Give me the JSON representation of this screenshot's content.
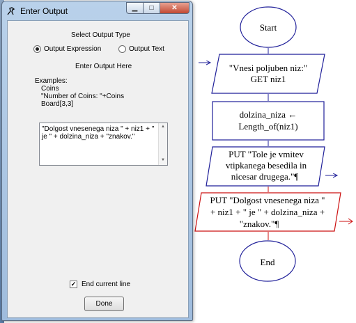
{
  "window": {
    "title": "Enter Output",
    "minimize_glyph": "▁",
    "maximize_glyph": "□",
    "close_glyph": "✕"
  },
  "dialog": {
    "select_type_label": "Select Output Type",
    "radio_expression_label": "Output Expression",
    "radio_text_label": "Output Text",
    "selected_type": "Output Expression",
    "enter_here_label": "Enter Output Here",
    "examples_heading": "Examples:",
    "example_1": "Coins",
    "example_2": "\"Number of Coins: \"+Coins",
    "example_3": "Board[3,3]",
    "output_value": "\"Dolgost vnesenega niza \" + niz1 + \" je \" + dolzina_niza + \"znakov.\"",
    "end_line_label": "End current line",
    "end_line_checked": true,
    "checkmark": "✓",
    "done_label": "Done"
  },
  "flowchart": {
    "start": "Start",
    "input_line1": "\"Vnesi poljuben niz:\"",
    "input_line2": "GET niz1",
    "assign_line1": "dolzina_niza ←",
    "assign_line2": "Length_of(niz1)",
    "put1_line1": "PUT \"Tole je vmitev",
    "put1_line2": "vtipkanega besedila in",
    "put1_line3": "nicesar drugega.\"¶",
    "put2_line1": "PUT \"Dolgost vnesenega niza \"",
    "put2_line2": "+ niz1 + \" je \" + dolzina_niza +",
    "put2_line3": "\"znakov.\"¶",
    "end": "End",
    "colors": {
      "shape": "#1f1f99",
      "selected": "#cc1111"
    }
  }
}
